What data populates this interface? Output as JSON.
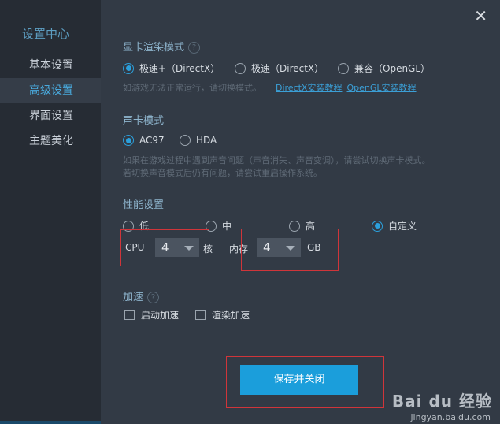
{
  "sidebar": {
    "title": "设置中心",
    "items": [
      {
        "label": "基本设置"
      },
      {
        "label": "高级设置",
        "active": true
      },
      {
        "label": "界面设置"
      },
      {
        "label": "主题美化"
      }
    ]
  },
  "close_symbol": "✕",
  "gpu": {
    "title": "显卡渲染模式",
    "options": [
      "极速+（DirectX）",
      "极速（DirectX）",
      "兼容（OpenGL）"
    ],
    "selected": 0,
    "hint": "如游戏无法正常运行，请切换模式。",
    "links": [
      "DirectX安装教程",
      "OpenGL安装教程"
    ]
  },
  "audio": {
    "title": "声卡模式",
    "options": [
      "AC97",
      "HDA"
    ],
    "selected": 0,
    "hint_lines": [
      "如果在游戏过程中遇到声音问题（声音消失、声音变调），请尝试切换声卡模式。",
      "若切换声音模式后仍有问题，请尝试重启操作系统。"
    ]
  },
  "performance": {
    "title": "性能设置",
    "options": [
      "低",
      "中",
      "高",
      "自定义"
    ],
    "selected": 3,
    "cpu_label": "CPU",
    "cpu_value": "4",
    "cpu_unit": "核",
    "mem_label": "内存",
    "mem_value": "4",
    "mem_unit": "GB"
  },
  "accel": {
    "title": "加速",
    "options": [
      "启动加速",
      "渲染加速"
    ]
  },
  "save_button": "保存并关闭",
  "watermark": {
    "brand": "Bai du 经验",
    "url": "jingyan.baidu.com"
  },
  "colors": {
    "accent": "#1b9edb",
    "highlight_box": "#d0353a"
  }
}
